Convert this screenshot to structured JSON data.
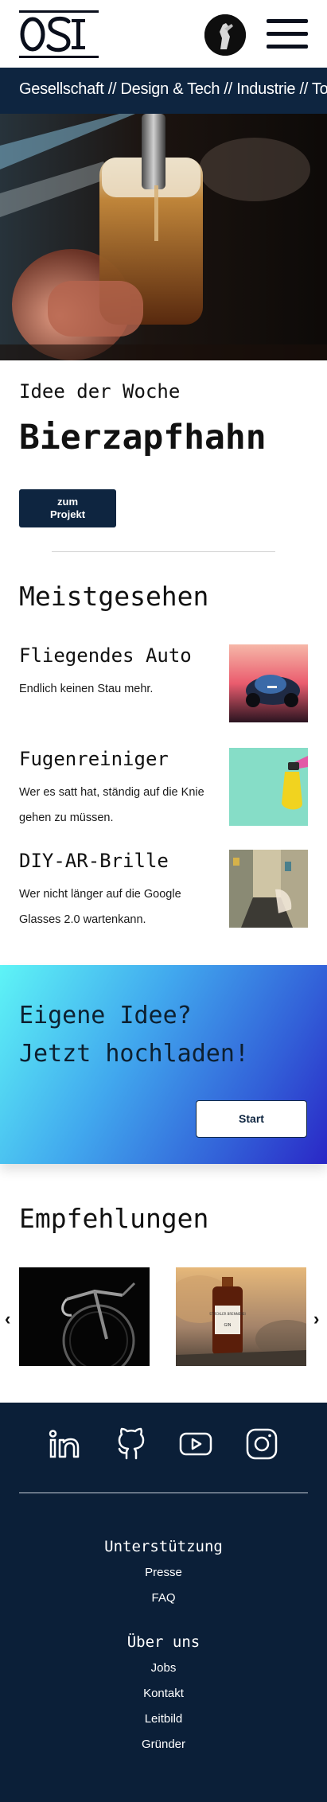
{
  "header": {
    "logo_alt": "OSI",
    "avatar_label": "user avatar",
    "menu_label": "menu"
  },
  "categories": "Gesellschaft // Design & Tech // Industrie // Tourismus",
  "idea": {
    "kicker": "Idee der Woche",
    "title": "Bierzapfhahn",
    "button_line1": "zum",
    "button_line2": "Projekt"
  },
  "most_viewed": {
    "title": "Meistgesehen",
    "items": [
      {
        "title": "Fliegendes Auto",
        "description": "Endlich keinen Stau mehr."
      },
      {
        "title": "Fugenreiniger",
        "description": "Wer es satt hat, ständig auf die Knie gehen zu müssen."
      },
      {
        "title": "DIY-AR-Brille",
        "description": "Wer nicht länger auf die Google Glasses 2.0 wartenkann."
      }
    ]
  },
  "upload": {
    "line1": "Eigene Idee?",
    "line2": "Jetzt hochladen!",
    "button": "Start"
  },
  "recommendations": {
    "title": "Empfehlungen",
    "prev": "‹",
    "next": "›",
    "bottle_label_top": "STÖCKLER BRENNEREI",
    "bottle_label_bottom": "GIN"
  },
  "footer": {
    "social": [
      "linkedin-icon",
      "github-icon",
      "youtube-icon",
      "instagram-icon"
    ],
    "support_heading": "Unterstützung",
    "support_links": [
      "Presse",
      "FAQ"
    ],
    "about_heading": "Über uns",
    "about_links": [
      "Jobs",
      "Kontakt",
      "Leitbild",
      "Gründer"
    ]
  },
  "colors": {
    "navy": "#0e2540",
    "footer_bg": "#0b1f38",
    "gradient_start": "#5ef4f6",
    "gradient_end": "#2a27c6"
  }
}
